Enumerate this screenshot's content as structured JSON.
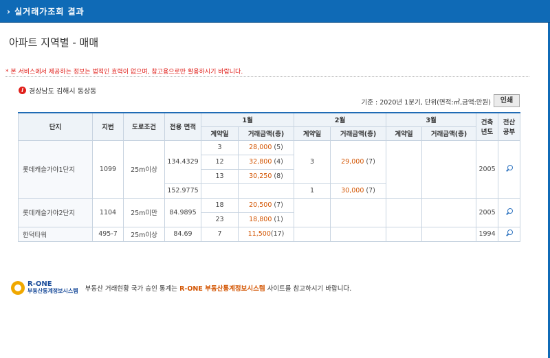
{
  "header": {
    "title": "› 실거래가조회 결과"
  },
  "page": {
    "subtitle": "아파트 지역별 - 매매",
    "notice": "* 본 서비스에서 제공하는 정보는 법적인 효력이 없으며, 참고용으로만 활용하시기 바랍니다.",
    "location": "경상남도 김해시 동상동",
    "basis": "기준 : 2020년 1분기, 단위(면적:㎡,금액:만원)",
    "print_label": "인쇄"
  },
  "table": {
    "headers": {
      "complex": "단지",
      "lot": "지번",
      "road": "도로조건",
      "area": "전용 면적",
      "m1": "1월",
      "m2": "2월",
      "m3": "3월",
      "year": "건축 년도",
      "register": "전산 공부",
      "contract_day": "계약일",
      "amount": "거래금액(층)"
    },
    "rows": {
      "r1": {
        "name": "롯데캐슬가야1단지",
        "lot": "1099",
        "road": "25m이상",
        "year": "2005",
        "area1": "134.4329",
        "area2": "152.9775",
        "m1": [
          {
            "day": "3",
            "amt": "28,000",
            "floor": "(5)"
          },
          {
            "day": "12",
            "amt": "32,800",
            "floor": "(4)"
          },
          {
            "day": "13",
            "amt": "30,250",
            "floor": "(8)"
          }
        ],
        "m2a": {
          "day": "3",
          "amt": "29,000",
          "floor": "(7)"
        },
        "m2b": {
          "day": "1",
          "amt": "30,000",
          "floor": "(7)"
        }
      },
      "r2": {
        "name": "롯데캐슬가야2단지",
        "lot": "1104",
        "road": "25m미만",
        "area": "84.9895",
        "year": "2005",
        "m1": [
          {
            "day": "18",
            "amt": "20,500",
            "floor": "(7)"
          },
          {
            "day": "23",
            "amt": "18,800",
            "floor": "(1)"
          }
        ]
      },
      "r3": {
        "name": "한덕타워",
        "lot": "495-7",
        "road": "25m이상",
        "area": "84.69",
        "year": "1994",
        "m1": {
          "day": "7",
          "amt": "11,500",
          "floor": "(17)"
        }
      }
    }
  },
  "footer": {
    "logo_top": "R-ONE",
    "logo_bottom": "부동산통계정보시스템",
    "msg_pre": "부동산 거래현황 국가 승인 통계는 ",
    "msg_highlight": "R-ONE 부동산통계정보시스템",
    "msg_post": " 사이트를 참고하시기 바랍니다."
  }
}
